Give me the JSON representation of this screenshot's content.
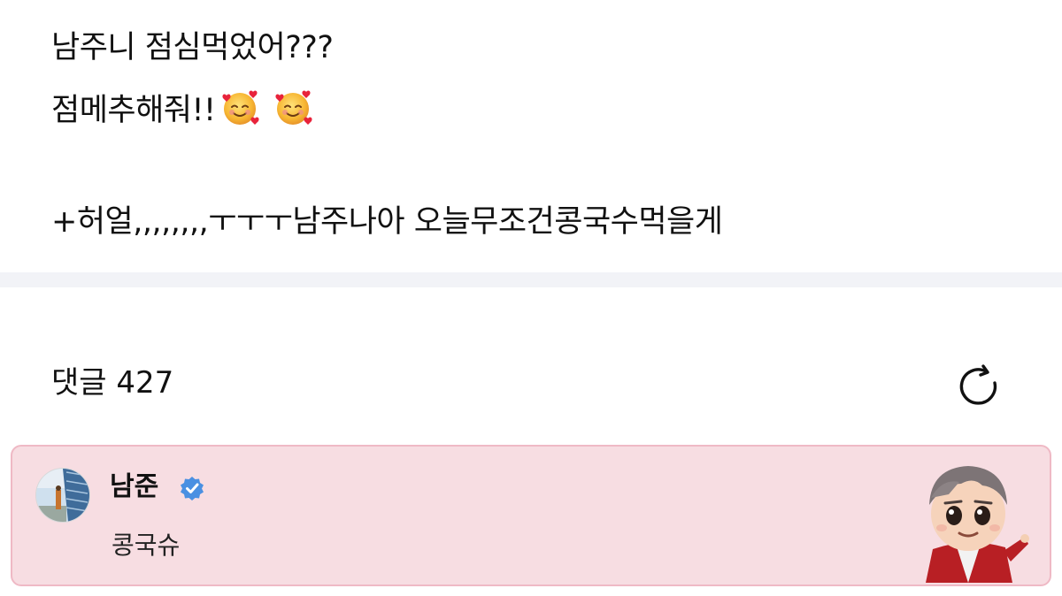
{
  "post": {
    "line1": "남주니 점심먹었어???",
    "line2": "점메추해줘!!",
    "line3": "+허얼,,,,,,,,ㅜㅜㅜ남주나아 오늘무조건콩국수먹을게",
    "emojis": [
      "smiling-face-with-hearts-icon",
      "smiling-face-with-hearts-icon"
    ]
  },
  "comments_section": {
    "label": "댓글 427",
    "refresh_icon": "refresh-icon"
  },
  "comment": {
    "author": "남준",
    "verified_icon": "verified-badge-icon",
    "text": "콩국슈",
    "accent_bg": "#f7dde2",
    "accent_border": "#efb9c5",
    "verified_color": "#4a90e2"
  }
}
